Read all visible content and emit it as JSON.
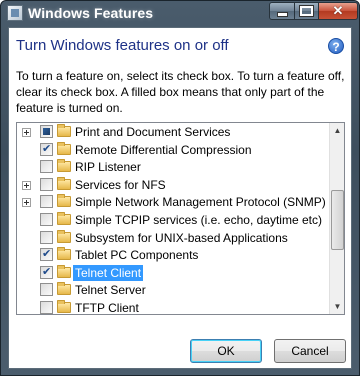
{
  "window": {
    "title": "Windows Features",
    "controls": {
      "minimize": "",
      "maximize": "",
      "close": "✕"
    }
  },
  "dialog": {
    "heading": "Turn Windows features on or off",
    "help_icon": "?",
    "description": "To turn a feature on, select its check box. To turn a feature off, clear its check box. A filled box means that only part of the feature is turned on."
  },
  "features": [
    {
      "label": "Print and Document Services",
      "expandable": true,
      "state": "partial"
    },
    {
      "label": "Remote Differential Compression",
      "expandable": false,
      "state": "checked"
    },
    {
      "label": "RIP Listener",
      "expandable": false,
      "state": "unchecked"
    },
    {
      "label": "Services for NFS",
      "expandable": true,
      "state": "unchecked"
    },
    {
      "label": "Simple Network Management Protocol (SNMP)",
      "expandable": true,
      "state": "unchecked"
    },
    {
      "label": "Simple TCPIP services (i.e. echo, daytime etc)",
      "expandable": false,
      "state": "unchecked"
    },
    {
      "label": "Subsystem for UNIX-based Applications",
      "expandable": false,
      "state": "unchecked"
    },
    {
      "label": "Tablet PC Components",
      "expandable": false,
      "state": "checked"
    },
    {
      "label": "Telnet Client",
      "expandable": false,
      "state": "checked",
      "selected": true
    },
    {
      "label": "Telnet Server",
      "expandable": false,
      "state": "unchecked"
    },
    {
      "label": "TFTP Client",
      "expandable": false,
      "state": "unchecked"
    }
  ],
  "icons": {
    "item_icon": "folder-icon",
    "expander": "plus-expander-icon"
  },
  "buttons": {
    "ok": "OK",
    "cancel": "Cancel"
  },
  "colors": {
    "selection": "#3399ff",
    "heading": "#1e3287"
  }
}
